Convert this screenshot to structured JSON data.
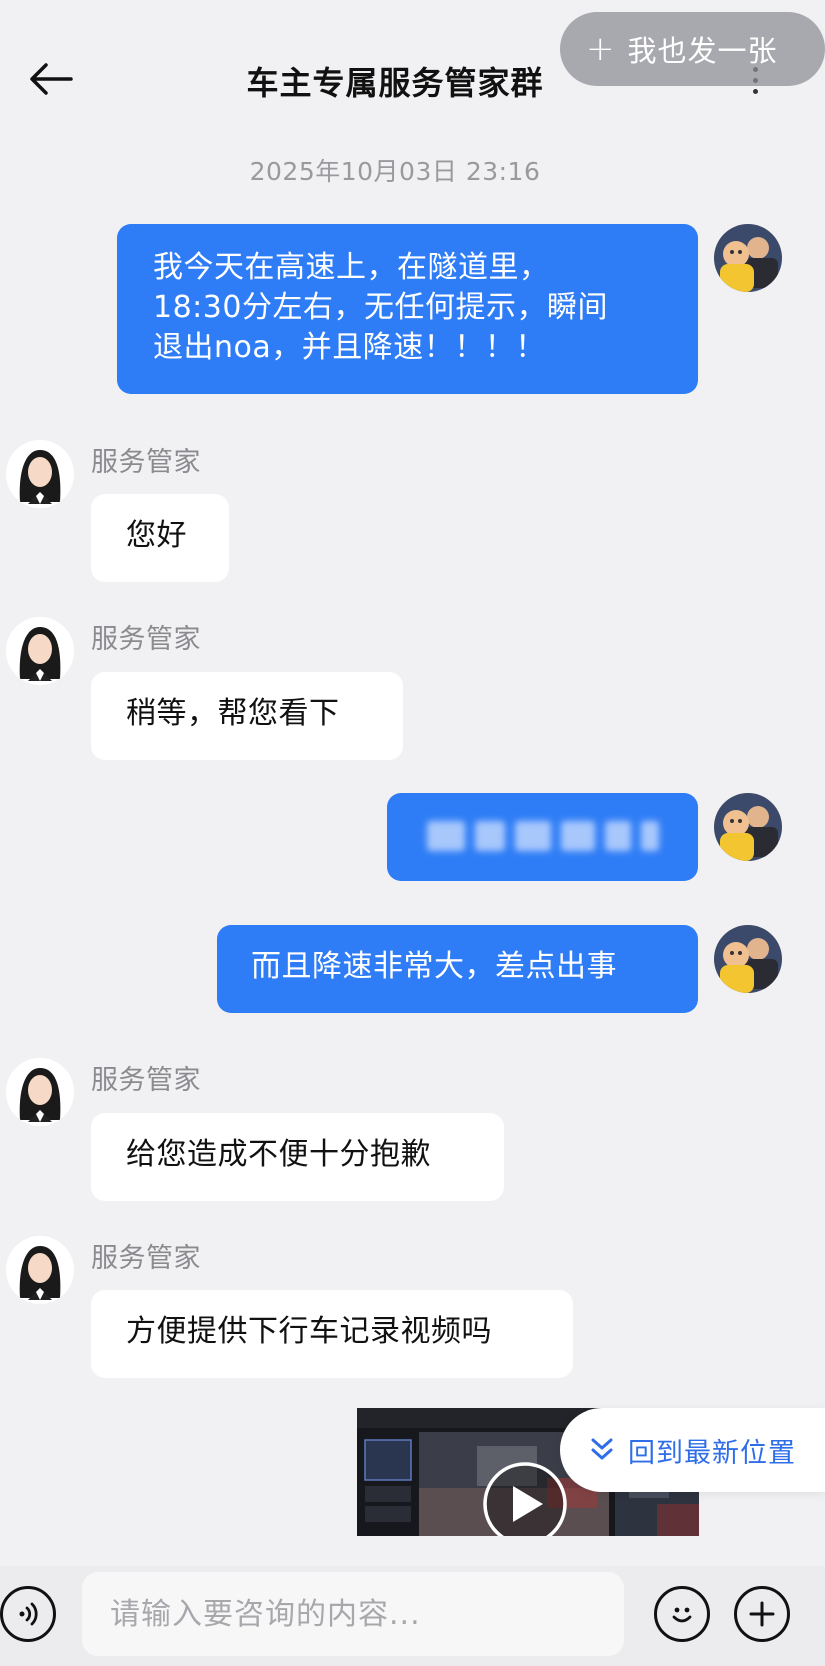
{
  "header": {
    "title": "车主专属服务管家群",
    "share_label": "我也发一张",
    "share_plus": "+"
  },
  "timestamp": "2025年10月03日 23:16",
  "messages": [
    {
      "direction": "out",
      "lines": [
        "我今天在高速上，在隧道里，",
        "18:30分左右，无任何提示，瞬间",
        "退出noa，并且降速！！！！"
      ]
    },
    {
      "direction": "in",
      "sender": "服务管家",
      "text": "您好"
    },
    {
      "direction": "in",
      "sender": "服务管家",
      "text": "稍等，帮您看下"
    },
    {
      "direction": "out",
      "text": "[blurred]"
    },
    {
      "direction": "out",
      "text": "而且降速非常大，差点出事"
    },
    {
      "direction": "in",
      "sender": "服务管家",
      "text": "给您造成不便十分抱歉"
    },
    {
      "direction": "in",
      "sender": "服务管家",
      "text": "方便提供下行车记录视频吗"
    }
  ],
  "scroll_to_latest_label": "回到最新位置",
  "input": {
    "placeholder": "请输入要咨询的内容..."
  },
  "colors": {
    "outgoing_bubble": "#2f7df6",
    "incoming_bubble": "#ffffff",
    "background": "#f1f1f3",
    "link_blue": "#2f6ee8"
  },
  "icons": [
    "back-arrow-icon",
    "more-icon",
    "plus-icon",
    "user-avatar",
    "agent-avatar",
    "play-icon",
    "double-chevron-down-icon",
    "voice-icon",
    "emoji-icon",
    "add-icon"
  ]
}
